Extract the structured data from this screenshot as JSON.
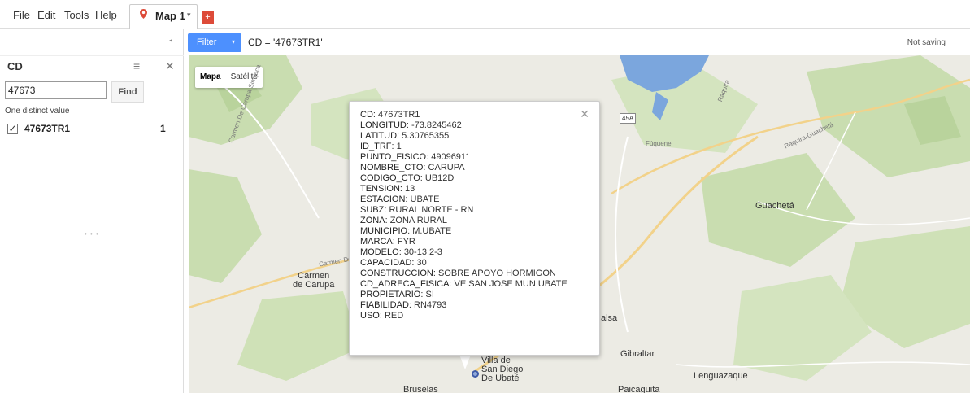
{
  "menu": {
    "file": "File",
    "edit": "Edit",
    "tools": "Tools",
    "help": "Help"
  },
  "tabs": {
    "map_tab": "Map 1",
    "map_tab_caret": "▾",
    "add_tab": "+"
  },
  "left_panel": {
    "collapse_glyph": "◂",
    "title": "CD",
    "menu_glyph": "≡",
    "minimize_glyph": "–",
    "close_glyph": "✕",
    "search_value": "47673",
    "find_label": "Find",
    "distinct_label": "One distinct value",
    "checked": true,
    "checkbox_glyph": "✓",
    "value_label": "47673TR1",
    "value_count": "1",
    "grip": "• • •"
  },
  "filter_bar": {
    "button_label": "Filter",
    "button_caret": "▾",
    "expression": "CD = '47673TR1'",
    "save_status": "Not saving"
  },
  "map": {
    "type_options": [
      "Mapa",
      "Satélite"
    ],
    "selected_type": "Mapa",
    "labels": {
      "carmen": "Carmen\nde Carupa",
      "guacheta": "Guachetá",
      "gibraltar": "Gibraltar",
      "lenguazaque": "Lenguazaque",
      "villa": "Villa de\nSan Diego\nDe Ubaté",
      "balsa": "alsa",
      "bruselas": "Bruselas",
      "paicaguita": "Paicaguita",
      "route": "45A",
      "road_carmen": "Carmen De Carupa Simijaca",
      "road_guacheta": "Raquira-Guachetá",
      "road_fuquene": "Fúquene",
      "road_raquira": "Ráquira",
      "road_carmen2": "Carmen De"
    }
  },
  "info_window": {
    "close_glyph": "✕",
    "rows": [
      {
        "key": "CD",
        "value": "47673TR1"
      },
      {
        "key": "LONGITUD",
        "value": "-73.8245462"
      },
      {
        "key": "LATITUD",
        "value": "5.30765355"
      },
      {
        "key": "ID_TRF",
        "value": "1"
      },
      {
        "key": "PUNTO_FISICO",
        "value": "49096911"
      },
      {
        "key": "NOMBRE_CTO",
        "value": "CARUPA"
      },
      {
        "key": "CODIGO_CTO",
        "value": "UB12D"
      },
      {
        "key": "TENSION",
        "value": "13"
      },
      {
        "key": "ESTACION",
        "value": "UBATE"
      },
      {
        "key": "SUBZ",
        "value": "RURAL NORTE - RN"
      },
      {
        "key": "ZONA",
        "value": "ZONA RURAL"
      },
      {
        "key": "MUNICIPIO",
        "value": "M.UBATE"
      },
      {
        "key": "MARCA",
        "value": "FYR"
      },
      {
        "key": "MODELO",
        "value": "30-13.2-3"
      },
      {
        "key": "CAPACIDAD",
        "value": "30"
      },
      {
        "key": "CONSTRUCCION",
        "value": "SOBRE APOYO HORMIGON"
      },
      {
        "key": "CD_ADRECA_FISICA",
        "value": "VE SAN JOSE MUN UBATE"
      },
      {
        "key": "PROPIETARIO",
        "value": "SI"
      },
      {
        "key": "FIABILIDAD",
        "value": "RN4793"
      },
      {
        "key": "USO",
        "value": "RED"
      }
    ]
  },
  "colors": {
    "accent_blue": "#4d90fe",
    "add_tab_red": "#dd4b39",
    "water": "#7ba6dd",
    "forest": "#c9ddb0"
  },
  "icons": {
    "map_pin": "map-pin-icon",
    "menu": "menu-icon",
    "minimize": "minimize-icon",
    "close": "close-icon",
    "marker": "map-marker-icon"
  }
}
